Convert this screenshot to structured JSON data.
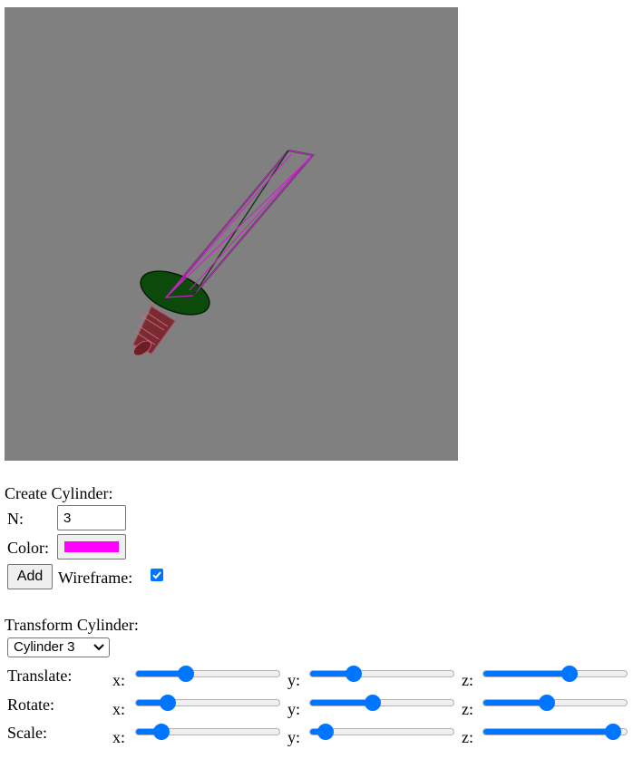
{
  "viewport": {
    "background": "#808080",
    "scene_colors": {
      "handle": "#8b2f3a",
      "guard": "#0b4a0b",
      "blade_wire": "#cc22cc",
      "blade_dark": "#1c3a1c"
    }
  },
  "create": {
    "heading": "Create Cylinder:",
    "n_label": "N:",
    "n_value": "3",
    "color_label": "Color:",
    "color_value": "#ff00ff",
    "add_label": "Add",
    "wireframe_label": "Wireframe:",
    "wireframe_checked": true
  },
  "transform": {
    "heading": "Transform Cylinder:",
    "selected": "Cylinder 3",
    "rows": [
      {
        "label": "Translate:",
        "values": {
          "x": 0.33,
          "y": 0.28,
          "z": 0.61
        }
      },
      {
        "label": "Rotate:",
        "values": {
          "x": 0.19,
          "y": 0.43,
          "z": 0.44
        }
      },
      {
        "label": "Scale:",
        "values": {
          "x": 0.14,
          "y": 0.06,
          "z": 0.95
        }
      }
    ],
    "axis_labels": {
      "x": "x:",
      "y": "y:",
      "z": "z:"
    }
  }
}
